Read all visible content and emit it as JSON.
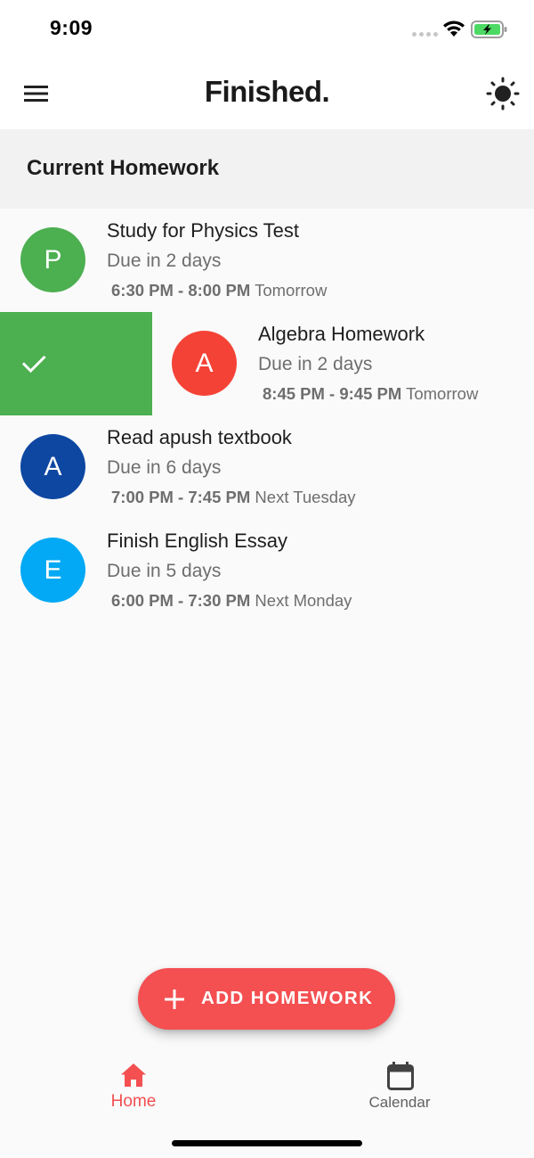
{
  "status_bar": {
    "time": "9:09",
    "battery_color": "#4cd964"
  },
  "app_bar": {
    "title": "Finished.",
    "menu_icon": "hamburger-menu-icon",
    "theme_icon": "sun-icon"
  },
  "section": {
    "title": "Current Homework"
  },
  "homework": [
    {
      "initial": "P",
      "title": "Study for Physics Test",
      "due": "Due in 2 days",
      "time_range": "6:30 PM - 8:00 PM",
      "day": "Tomorrow",
      "avatar_color": "#4caf50"
    },
    {
      "initial": "A",
      "title": "Algebra Homework",
      "due": "Due in 2 days",
      "time_range": "8:45 PM - 9:45 PM",
      "day": "Tomorrow",
      "avatar_color": "#f44336",
      "swipe_action_color": "#4caf50",
      "swipe_action_icon": "check-icon"
    },
    {
      "initial": "A",
      "title": "Read apush textbook",
      "due": "Due in 6 days",
      "time_range": "7:00 PM - 7:45 PM",
      "day": "Next Tuesday",
      "avatar_color": "#0d47a1"
    },
    {
      "initial": "E",
      "title": "Finish English Essay",
      "due": "Due in 5 days",
      "time_range": "6:00 PM - 7:30 PM",
      "day": "Next Monday",
      "avatar_color": "#03a9f4"
    }
  ],
  "fab": {
    "label": "ADD HOMEWORK",
    "icon": "plus-icon",
    "color": "#f44f51"
  },
  "bottom_nav": {
    "home_label": "Home",
    "calendar_label": "Calendar",
    "active": "Home",
    "active_color": "#f44f51"
  }
}
